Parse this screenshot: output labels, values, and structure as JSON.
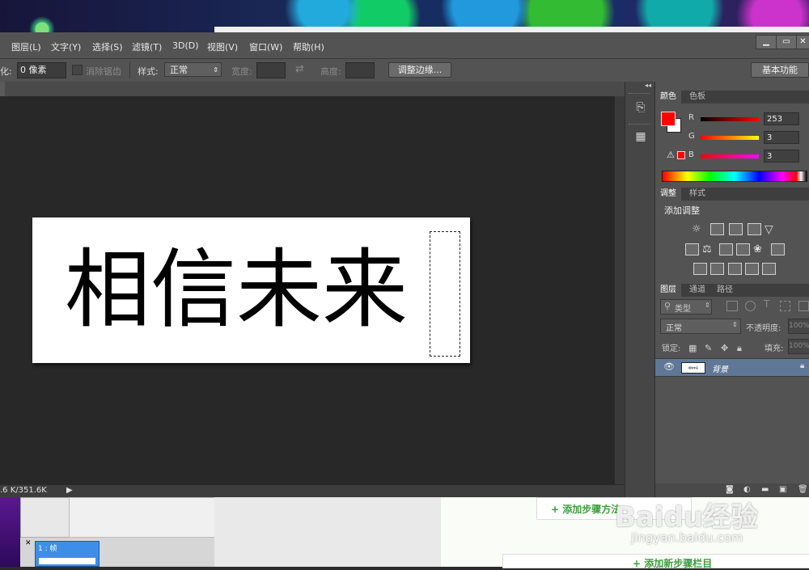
{
  "menubar": {
    "items": [
      "图层(L)",
      "文字(Y)",
      "选择(S)",
      "滤镜(T)",
      "3D(D)",
      "视图(V)",
      "窗口(W)",
      "帮助(H)"
    ],
    "window_buttons": [
      "▁",
      "▭",
      "✕"
    ]
  },
  "options": {
    "feather_label": "化:",
    "feather_value": "0 像素",
    "antialias_label": "消除锯齿",
    "style_label": "样式:",
    "style_value": "正常",
    "width_label": "宽度:",
    "height_label": "高度:",
    "refine_edge": "调整边缘...",
    "workspace": "基本功能"
  },
  "canvas": {
    "text": "相信未来"
  },
  "status": {
    "doc_size": ".6 K/351.6K",
    "arrow": "▶"
  },
  "dock": {
    "collapse_glyph": "◂◂"
  },
  "color_panel": {
    "tabs": [
      "颜色",
      "色板"
    ],
    "r_label": "R",
    "g_label": "G",
    "b_label": "B",
    "r": "253",
    "g": "3",
    "b": "3",
    "warning_glyph": "⚠",
    "foreground_color": "#fd0303"
  },
  "adjust_panel": {
    "tabs": [
      "调整",
      "样式"
    ],
    "title": "添加调整"
  },
  "layers_panel": {
    "tabs": [
      "图层",
      "通道",
      "路径"
    ],
    "filter_type": "类型",
    "blend_mode": "正常",
    "opacity_label": "不透明度:",
    "opacity_value": "100%",
    "lock_label": "锁定:",
    "fill_label": "填充:",
    "fill_value": "100%",
    "layer_name": "背景",
    "thumb_text": "相信未来"
  },
  "bottom": {
    "frame_label": "1 : 帧",
    "add_method": "+ 添加步骤方法",
    "add_new": "+ 添加新步骤栏目",
    "watermark_main": "Baidu经验",
    "watermark_url": "jingyan.baidu.com"
  }
}
